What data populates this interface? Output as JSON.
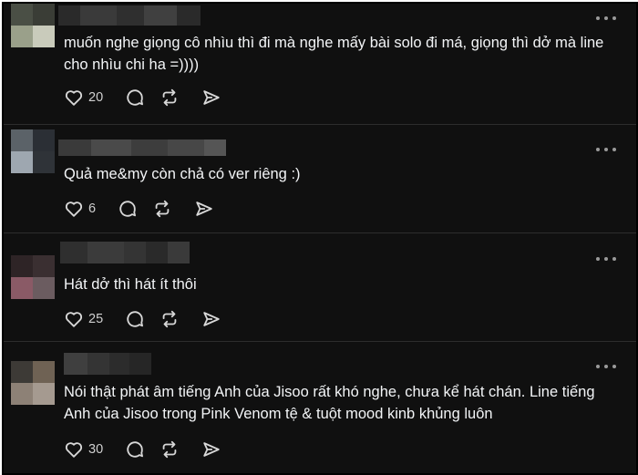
{
  "posts": [
    {
      "text": "muốn nghe giọng cô nhìu thì đi mà nghe mấy bài solo đi má, giọng thì dở mà line cho nhìu chi ha =))))",
      "likes": "20",
      "avatar_colors": [
        "#4a4f45",
        "#3a3d36",
        "#9aa08a",
        "#c9cbbb"
      ],
      "name_blur_colors": [
        "#2a2a2a",
        "#3a3a3a",
        "#2f2f2f",
        "#404040",
        "#2a2a2a"
      ]
    },
    {
      "text": "Quả me&my còn chả có ver riêng :)",
      "likes": "6",
      "avatar_colors": [
        "#5b6268",
        "#2b2f35",
        "#9ea7b0",
        "#2f3338"
      ],
      "name_blur_colors": [
        "#3a3a3a",
        "#4a4a4a",
        "#3d3d3d",
        "#474747",
        "#555555"
      ]
    },
    {
      "text": "Hát dở thì hát ít thôi",
      "likes": "25",
      "avatar_colors": [
        "#2e2426",
        "#3a2f31",
        "#8a5a66",
        "#6b5c60"
      ],
      "name_blur_colors": [
        "#2f2f2f",
        "#3b3b3b",
        "#343434",
        "#2a2a2a",
        "#3a3a3a"
      ]
    },
    {
      "text": "Nói thật phát âm tiếng Anh của Jisoo rất khó nghe, chưa kể hát chán. Line tiếng Anh của Jisoo trong Pink Venom tệ & tuột mood kinb khủng luôn",
      "likes": "30",
      "avatar_colors": [
        "#3d3a36",
        "#6f6254",
        "#8d8176",
        "#a59a90"
      ],
      "name_blur_colors": [
        "#3f3f3f",
        "#343434",
        "#2c2c2c",
        "#262626"
      ]
    }
  ],
  "icons": [
    "heart-icon",
    "comment-icon",
    "repost-icon",
    "share-icon",
    "more-icon"
  ]
}
